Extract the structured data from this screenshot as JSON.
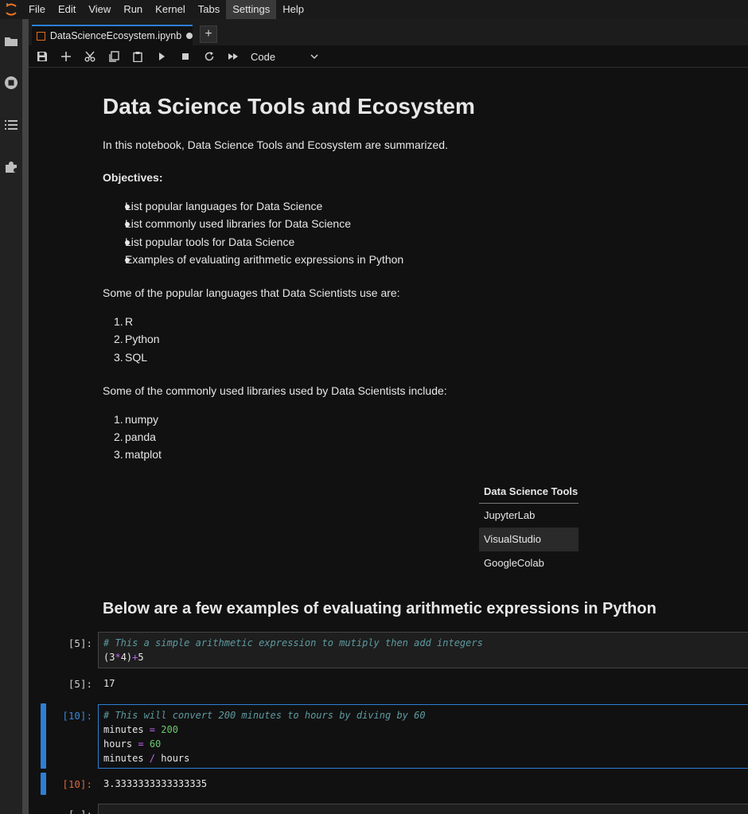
{
  "menubar": {
    "items": [
      "File",
      "Edit",
      "View",
      "Run",
      "Kernel",
      "Tabs",
      "Settings",
      "Help"
    ]
  },
  "leftbar": {
    "icons": [
      "folder-icon",
      "running-icon",
      "toc-icon",
      "extension-icon"
    ]
  },
  "tab": {
    "title": "DataScienceEcosystem.ipynb",
    "new_tab_label": "+"
  },
  "toolbar": {
    "cell_type": "Code"
  },
  "notebook": {
    "title": "Data Science Tools and Ecosystem",
    "intro": "In this notebook, Data Science Tools and Ecosystem are summarized.",
    "objectives_heading": "Objectives:",
    "objectives": [
      "List popular languages for Data Science",
      "List commonly used libraries for Data Science",
      "List popular tools for Data Science",
      "Examples of evaluating arithmetic expressions in Python"
    ],
    "languages_intro": "Some of the popular languages that Data Scientists use are:",
    "languages": [
      "R",
      "Python",
      "SQL"
    ],
    "libraries_intro": "Some of the commonly used libraries used by Data Scientists include:",
    "libraries": [
      "numpy",
      "panda",
      "matplot"
    ],
    "tools_table": {
      "header": "Data Science Tools",
      "rows": [
        "JupyterLab",
        "VisualStudio",
        "GoogleColab"
      ]
    },
    "arith_heading": "Below are a few examples of evaluating arithmetic expressions in Python",
    "cells": [
      {
        "in_prompt": "[5]:",
        "comment": "# This a simple arithmetic expression to mutiply then add integers",
        "out_prompt": "[5]:",
        "output": "17"
      },
      {
        "in_prompt": "[10]:",
        "comment": "# This will convert 200 minutes to hours by diving by 60",
        "out_prompt": "[10]:",
        "output": "3.3333333333333335"
      }
    ],
    "next_prompt": "[ ]:"
  }
}
